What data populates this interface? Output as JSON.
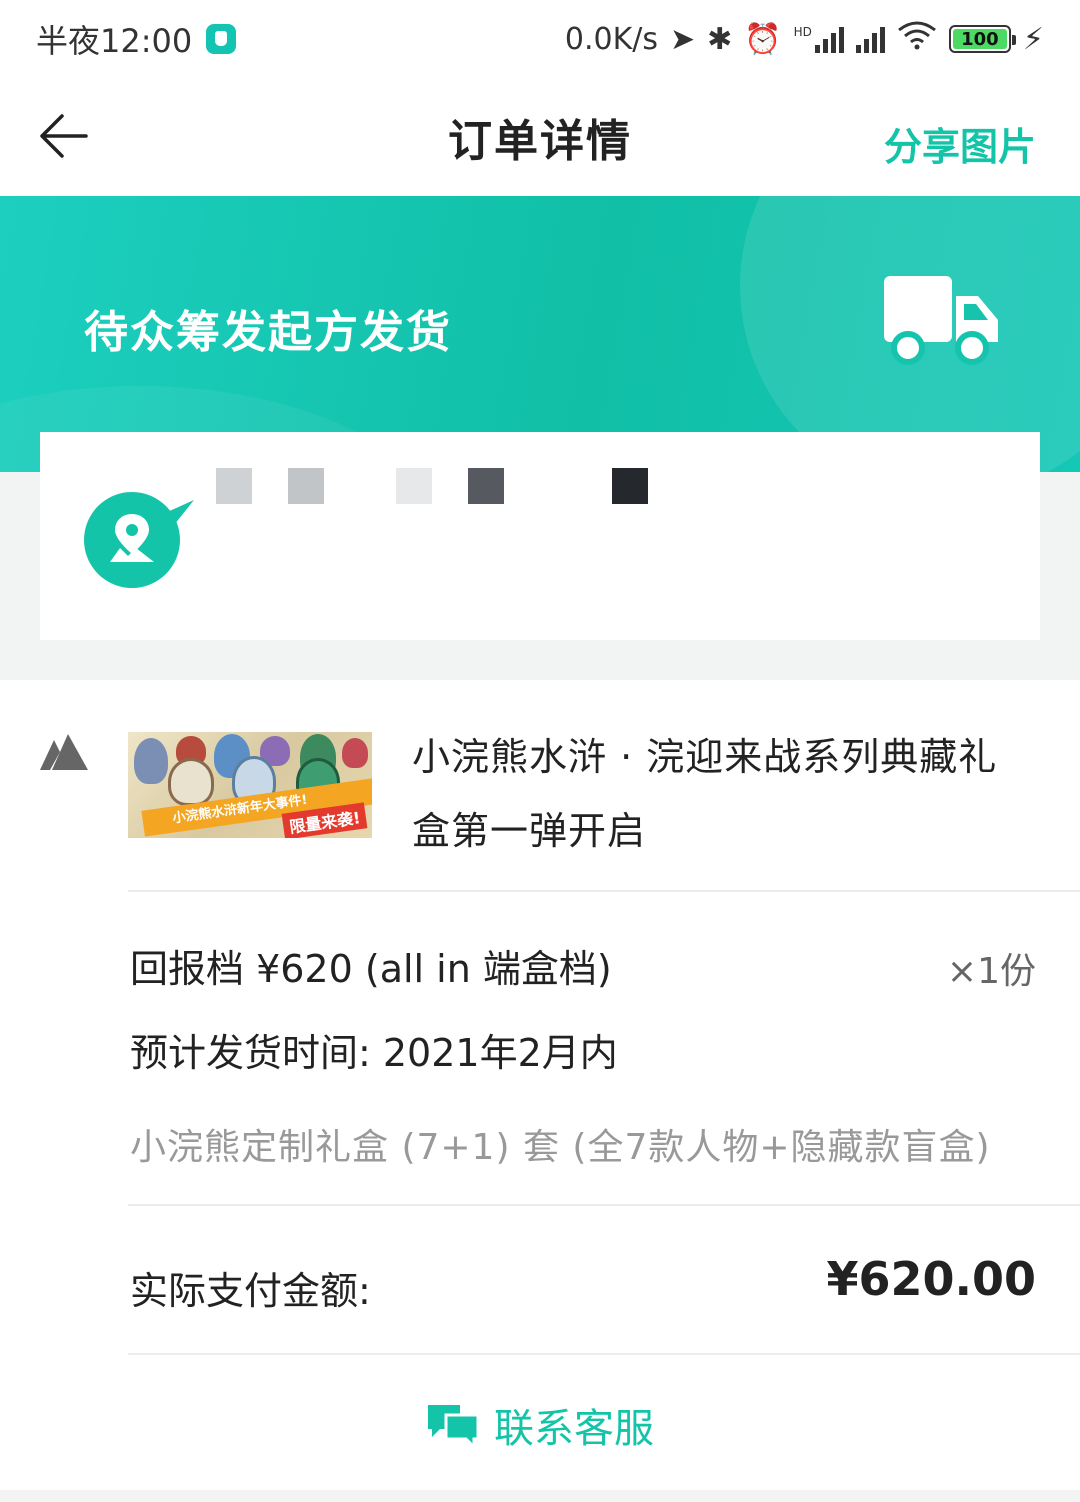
{
  "status_bar": {
    "time": "半夜12:00",
    "net_speed": "0.0K/s",
    "signal_label": "HD",
    "battery": "100"
  },
  "nav": {
    "title": "订单详情",
    "share_label": "分享图片"
  },
  "banner": {
    "status_text": "待众筹发起方发货"
  },
  "product": {
    "title": "小浣熊水浒 · 浣迎来战系列典藏礼盒第一弹开启",
    "thumb_strip": "小浣熊水浒新年大事件!",
    "thumb_tag": "限量来袭!"
  },
  "order": {
    "tier": "回报档 ¥620 (all in 端盒档)",
    "quantity": "×1份",
    "ship_time": "预计发货时间: 2021年2月内",
    "description": "小浣熊定制礼盒 (7+1) 套 (全7款人物+隐藏款盲盒)",
    "paid_label": "实际支付金额:",
    "paid_amount": "¥620.00"
  },
  "support": {
    "label": "联系客服"
  },
  "colors": {
    "accent": "#14c4a9",
    "banner_start": "#1ccfbf",
    "banner_end": "#11bfa6"
  },
  "icons": [
    "back-arrow-icon",
    "truck-icon",
    "location-pin-icon",
    "shop-icon",
    "chat-bubble-icon"
  ]
}
